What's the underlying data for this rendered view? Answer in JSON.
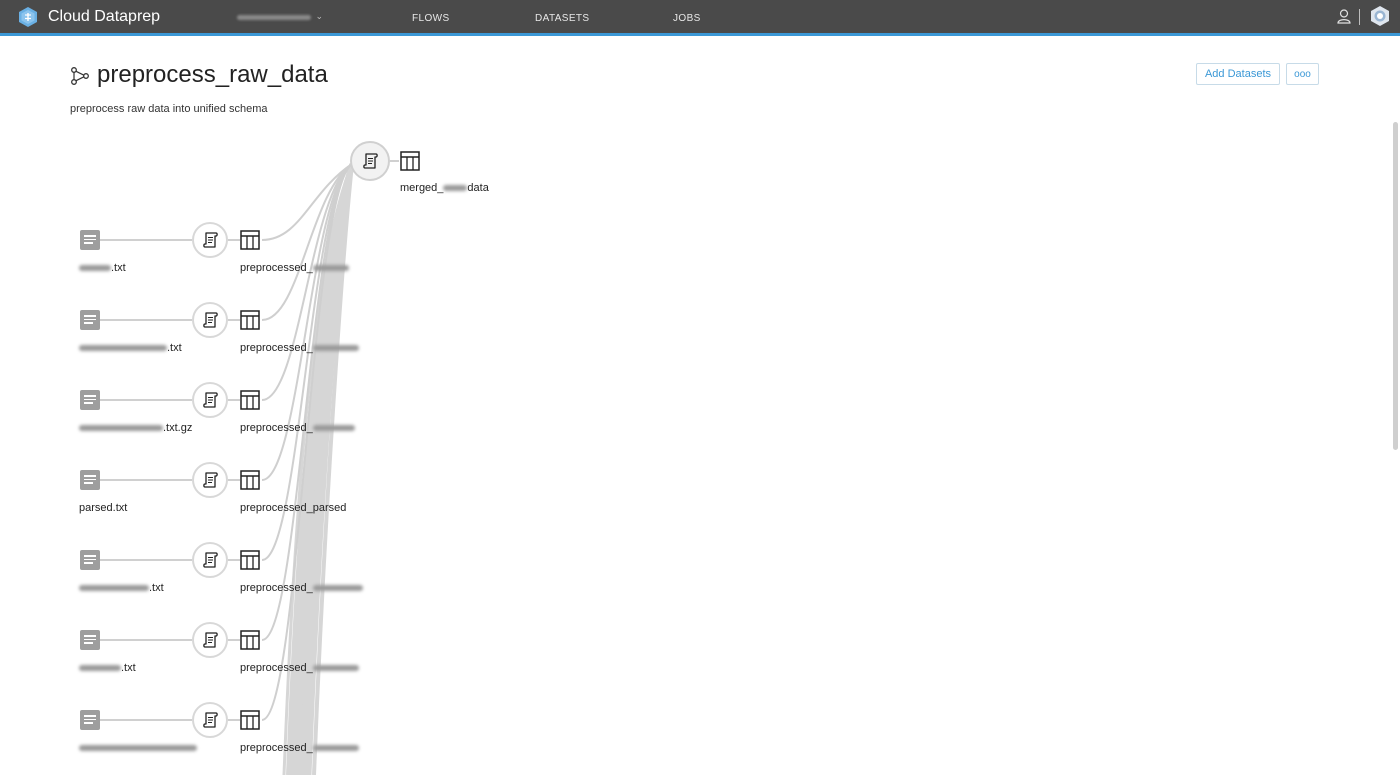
{
  "app": {
    "title": "Cloud Dataprep",
    "nav": [
      {
        "label": "FLOWS"
      },
      {
        "label": "DATASETS"
      },
      {
        "label": "JOBS"
      }
    ],
    "accent_color": "#3b98d6",
    "topbar_color": "#4a4a4a",
    "icons": {
      "logo": "dataprep-hexagon-logo",
      "user": "user-icon",
      "help": "help-icon"
    }
  },
  "flow": {
    "title": "preprocess_raw_data",
    "description": "preprocess raw data into unified schema",
    "add_datasets_label": "Add Datasets",
    "more_label": "ooo"
  },
  "graph": {
    "output": {
      "prefix": "merged_",
      "suffix": "data"
    },
    "rows": [
      {
        "source_suffix": ".txt",
        "output_prefix": "preprocessed_",
        "output_suffix": ""
      },
      {
        "source_suffix": ".txt",
        "output_prefix": "preprocessed_",
        "output_suffix": ""
      },
      {
        "source_suffix": ".txt.gz",
        "output_prefix": "preprocessed_",
        "output_suffix": ""
      },
      {
        "source_suffix": "parsed.txt",
        "output_prefix": "preprocessed_",
        "output_suffix": "parsed"
      },
      {
        "source_suffix": ".txt",
        "output_prefix": "preprocessed_",
        "output_suffix": ""
      },
      {
        "source_suffix": ".txt",
        "output_prefix": "preprocessed_",
        "output_suffix": ""
      },
      {
        "source_suffix": "",
        "output_prefix": "preprocessed_",
        "output_suffix": ""
      }
    ]
  }
}
